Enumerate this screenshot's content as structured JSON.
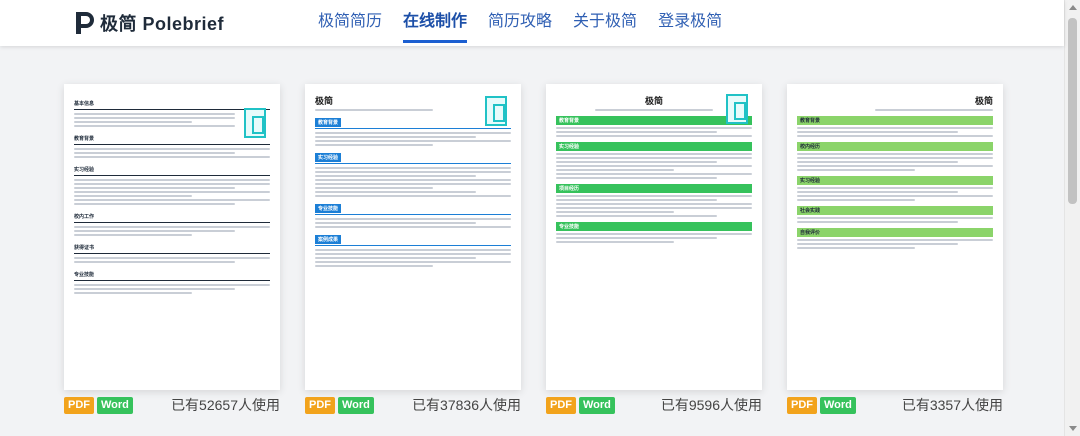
{
  "header": {
    "logo_text": "极简 Polebrief",
    "nav": [
      {
        "label": "极简简历",
        "active": false
      },
      {
        "label": "在线制作",
        "active": true
      },
      {
        "label": "简历攻略",
        "active": false
      },
      {
        "label": "关于极简",
        "active": false
      },
      {
        "label": "登录极简",
        "active": false
      }
    ]
  },
  "templates": [
    {
      "formats": [
        "PDF",
        "Word"
      ],
      "usage": "已有52657人使用",
      "accent": "#1f2b3a",
      "name": "",
      "sections": [
        "基本信息",
        "教育背景",
        "实习经验",
        "校内工作",
        "获得证书",
        "专业技能"
      ]
    },
    {
      "formats": [
        "PDF",
        "Word"
      ],
      "usage": "已有37836人使用",
      "accent": "#1c7fd6",
      "name": "极简",
      "sections": [
        "教育背景",
        "实习经验",
        "专业技能",
        "案例成果"
      ]
    },
    {
      "formats": [
        "PDF",
        "Word"
      ],
      "usage": "已有9596人使用",
      "accent": "#36c25c",
      "name": "极简",
      "sections": [
        "教育背景",
        "实习经验",
        "项目经历",
        "专业技能"
      ]
    },
    {
      "formats": [
        "PDF",
        "Word"
      ],
      "usage": "已有3357人使用",
      "accent": "#8bd46a",
      "name": "极简",
      "sections": [
        "教育背景",
        "校内经历",
        "实习经验",
        "社会实践",
        "自我评价"
      ]
    }
  ]
}
